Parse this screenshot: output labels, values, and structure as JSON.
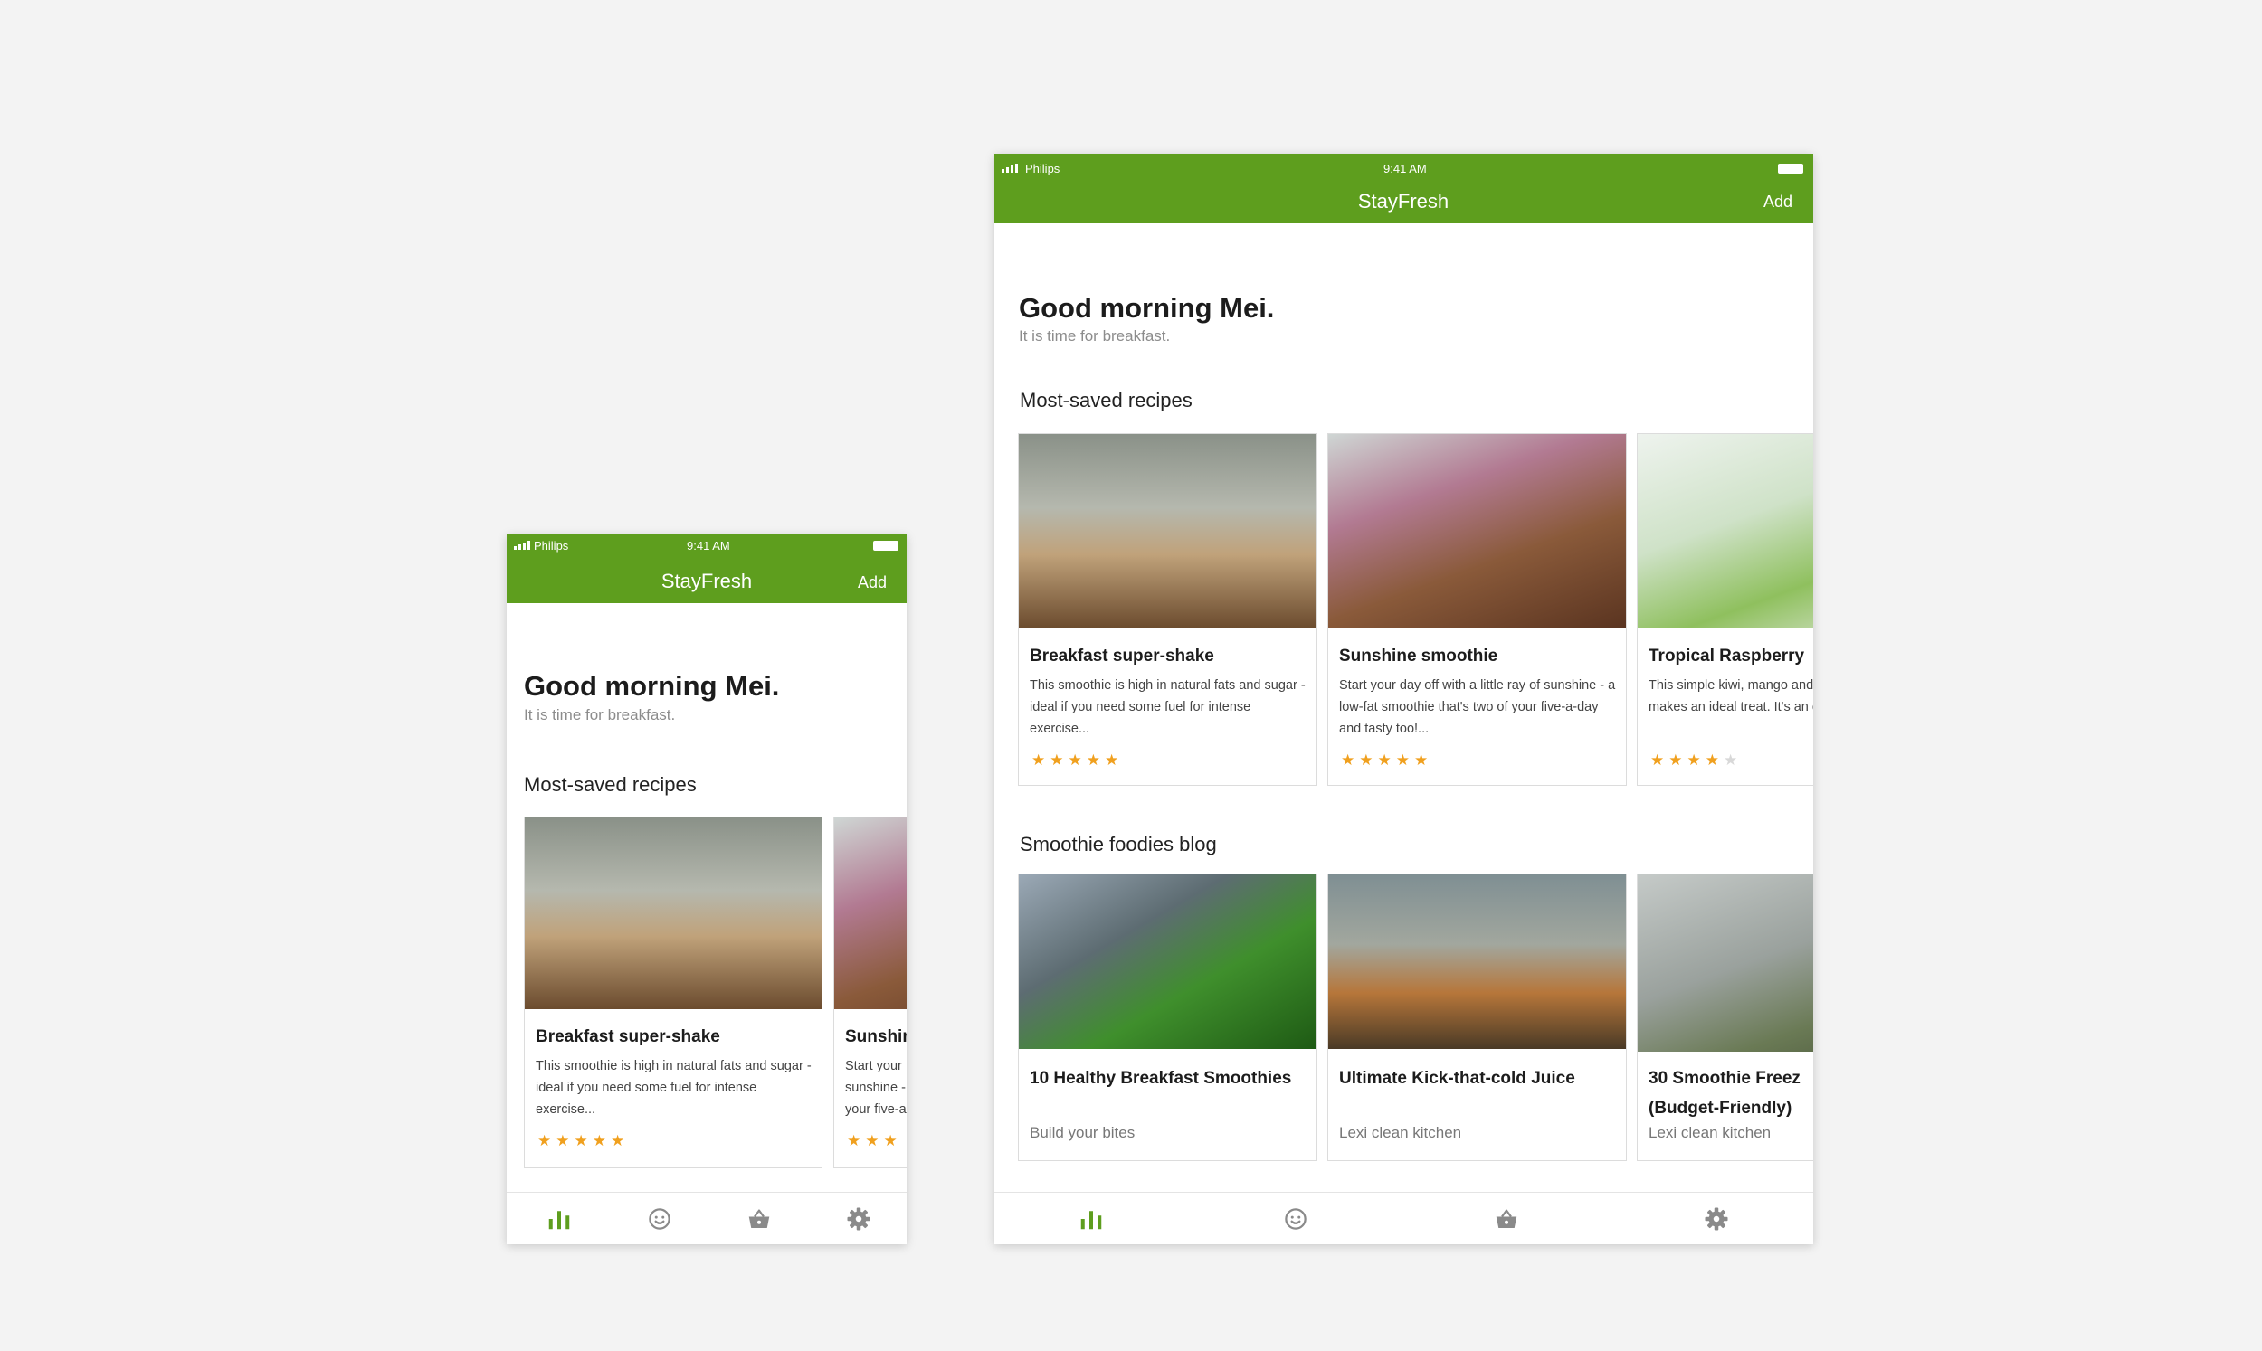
{
  "colors": {
    "brand_green": "#5e9e1e",
    "star_active": "#f0a01e",
    "star_inactive": "#d8d8d8",
    "nav_inactive": "#8a8a8a"
  },
  "status_bar": {
    "carrier": "Philips",
    "time": "9:41 AM"
  },
  "app_bar": {
    "title": "StayFresh",
    "add_label": "Add"
  },
  "greeting": {
    "title": "Good morning Mei.",
    "subtitle": "It is time for breakfast."
  },
  "sections": {
    "recipes": "Most-saved recipes",
    "blog": "Smoothie foodies blog"
  },
  "recipes": [
    {
      "title": "Breakfast super-shake",
      "description": "This smoothie is high in natural fats and sugar - ideal if you need some fuel for intense exercise...",
      "rating": 5,
      "max_rating": 5,
      "stars": "★★★★★"
    },
    {
      "title": "Sunshine smoothie",
      "description": "Start your day off with a little ray of sunshine - a low-fat smoothie that's two of your five-a-day and tasty too!...",
      "rating": 5,
      "max_rating": 5,
      "stars": "★★★★★"
    },
    {
      "title": "Tropical Raspberry",
      "description": "This simple kiwi, mango and fruit smoothie makes an ideal treat. It's an easy way to p",
      "rating": 4,
      "max_rating": 5,
      "stars_on": "★★★★",
      "stars_off": "★"
    }
  ],
  "phone_second_card": {
    "title": "Sunshir",
    "description": "Start your sunshine - your five-a",
    "stars": "★★★"
  },
  "blog": [
    {
      "title": "10 Healthy Breakfast Smoothies",
      "author": "Build your bites"
    },
    {
      "title": "Ultimate Kick-that-cold Juice",
      "author": "Lexi clean kitchen"
    },
    {
      "title": "30 Smoothie Freez (Budget-Friendly)",
      "author": "Lexi clean kitchen"
    }
  ],
  "bottom_nav": {
    "items": [
      {
        "icon": "bar-chart-icon",
        "active": true
      },
      {
        "icon": "face-icon",
        "active": false
      },
      {
        "icon": "basket-icon",
        "active": false
      },
      {
        "icon": "gear-icon",
        "active": false
      }
    ]
  }
}
